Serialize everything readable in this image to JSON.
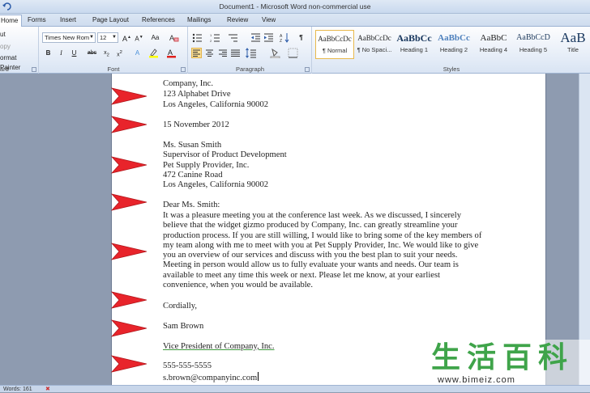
{
  "window": {
    "title": "Document1 - Microsoft Word non-commercial use"
  },
  "tabs": [
    "Home",
    "Insert",
    "Page Layout",
    "References",
    "Mailings",
    "Review",
    "View"
  ],
  "tab_forms": "Forms",
  "clipboard": {
    "cut": "ut",
    "copy": "opy",
    "format_painter": "ormat Painter",
    "label": "ard"
  },
  "font": {
    "name": "Times New Rom",
    "size": "12",
    "label": "Font"
  },
  "paragraph": {
    "label": "Paragraph"
  },
  "styles": {
    "label": "Styles",
    "items": [
      {
        "preview": "AaBbCcDc",
        "name": "¶ Normal"
      },
      {
        "preview": "AaBbCcDc",
        "name": "¶ No Spaci..."
      },
      {
        "preview": "AaBbCc",
        "name": "Heading 1"
      },
      {
        "preview": "AaBbCc",
        "name": "Heading 2"
      },
      {
        "preview": "AaBbC",
        "name": "Heading 4"
      },
      {
        "preview": "AaBbCcD",
        "name": "Heading 5"
      },
      {
        "preview": "AaB",
        "name": "Title"
      }
    ]
  },
  "document": {
    "lines": [
      "Company, Inc.",
      "123 Alphabet Drive",
      "Los Angeles, California 90002",
      "15 November 2012",
      "Ms. Susan Smith",
      "Supervisor of Product Development",
      "Pet Supply Provider, Inc.",
      "472 Canine Road",
      "Los Angeles, California 90002",
      "Dear Ms. Smith:",
      "It was a pleasure meeting you at the conference last week. As we discussed, I sincerely",
      "believe that the widget gizmo produced by Company, Inc. can greatly streamline  your",
      "production process. If you are still willing, I would like to bring some of the key members  of",
      "my team along with me to meet with you at Pet Supply Provider, Inc. We would like to give",
      "you an overview of our services  and discuss with you the best plan to suit your needs.",
      "Meeting in person would allow us to fully evaluate your wants and needs. Our team is",
      "available to meet any time this week or next. Please let me know, at your earliest",
      "convenience, when you would be available.",
      "Cordially,",
      "Sam Brown",
      "Vice President of Company, Inc.",
      "555-555-5555",
      "s.brown@companyinc.com"
    ]
  },
  "status": {
    "words": "Words: 161"
  },
  "watermark": {
    "chars": "生活百科",
    "url": "www.bimeiz.com"
  },
  "colors": {
    "arrow": "#e8242b",
    "accent_tab": "#ffffff",
    "ribbon": "#dde7f4"
  }
}
